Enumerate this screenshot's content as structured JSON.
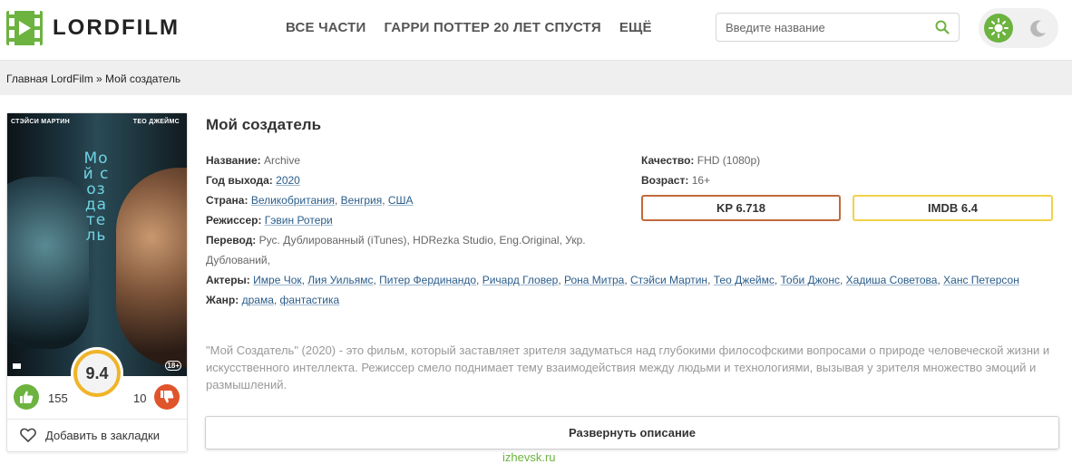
{
  "header": {
    "logo_text": "LORDFILM",
    "nav": [
      "ВСЕ ЧАСТИ",
      "ГАРРИ ПОТТЕР 20 ЛЕТ СПУСТЯ",
      "ЕЩЁ"
    ],
    "search_placeholder": "Введите название",
    "accent_color": "#6cb33f"
  },
  "breadcrumb": "Главная LordFilm » Мой создатель",
  "poster": {
    "actor_left": "СТЭЙСИ МАРТИН",
    "actor_right": "ТЕО ДЖЕЙМС",
    "vertical_title": "Мой создатель",
    "age_badge": "18+",
    "rating": "9.4",
    "likes": "155",
    "dislikes": "10",
    "bookmark_label": "Добавить в закладки"
  },
  "movie": {
    "title": "Мой создатель",
    "name_label": "Название:",
    "name_value": "Archive",
    "year_label": "Год выхода:",
    "year_value": "2020",
    "country_label": "Страна:",
    "countries": [
      "Великобритания",
      "Венгрия",
      "США"
    ],
    "director_label": "Режиссер:",
    "director": "Гэвин Ротери",
    "translation_label": "Перевод:",
    "translation_value": "Рус. Дублированный (iTunes), HDRezka Studio, Eng.Original, Укр. Дублований,",
    "actors_label": "Актеры:",
    "actors": [
      "Имре Чок",
      "Лия Уильямс",
      "Питер Фердинандо",
      "Ричард Гловер",
      "Рона Митра",
      "Стэйси Мартин",
      "Тео Джеймс",
      "Тоби Джонс",
      "Хадиша Советова",
      "Ханс Петерсон"
    ],
    "genre_label": "Жанр:",
    "genres": [
      "драма",
      "фантастика"
    ],
    "quality_label": "Качество:",
    "quality_value": "FHD (1080p)",
    "age_label": "Возраст:",
    "age_value": "16+",
    "kp_rating": "KP 6.718",
    "imdb_rating": "IMDB 6.4",
    "description": "\"Мой Создатель\" (2020) - это фильм, который заставляет зрителя задуматься над глубокими философскими вопросами о природе человеческой жизни и искусственного интеллекта. Режиссер смело поднимает тему взаимодействия между людьми и технологиями, вызывая у зрителя множество эмоций и размышлений.",
    "expand_label": "Развернуть описание"
  },
  "watermark": "izhevsk.ru"
}
